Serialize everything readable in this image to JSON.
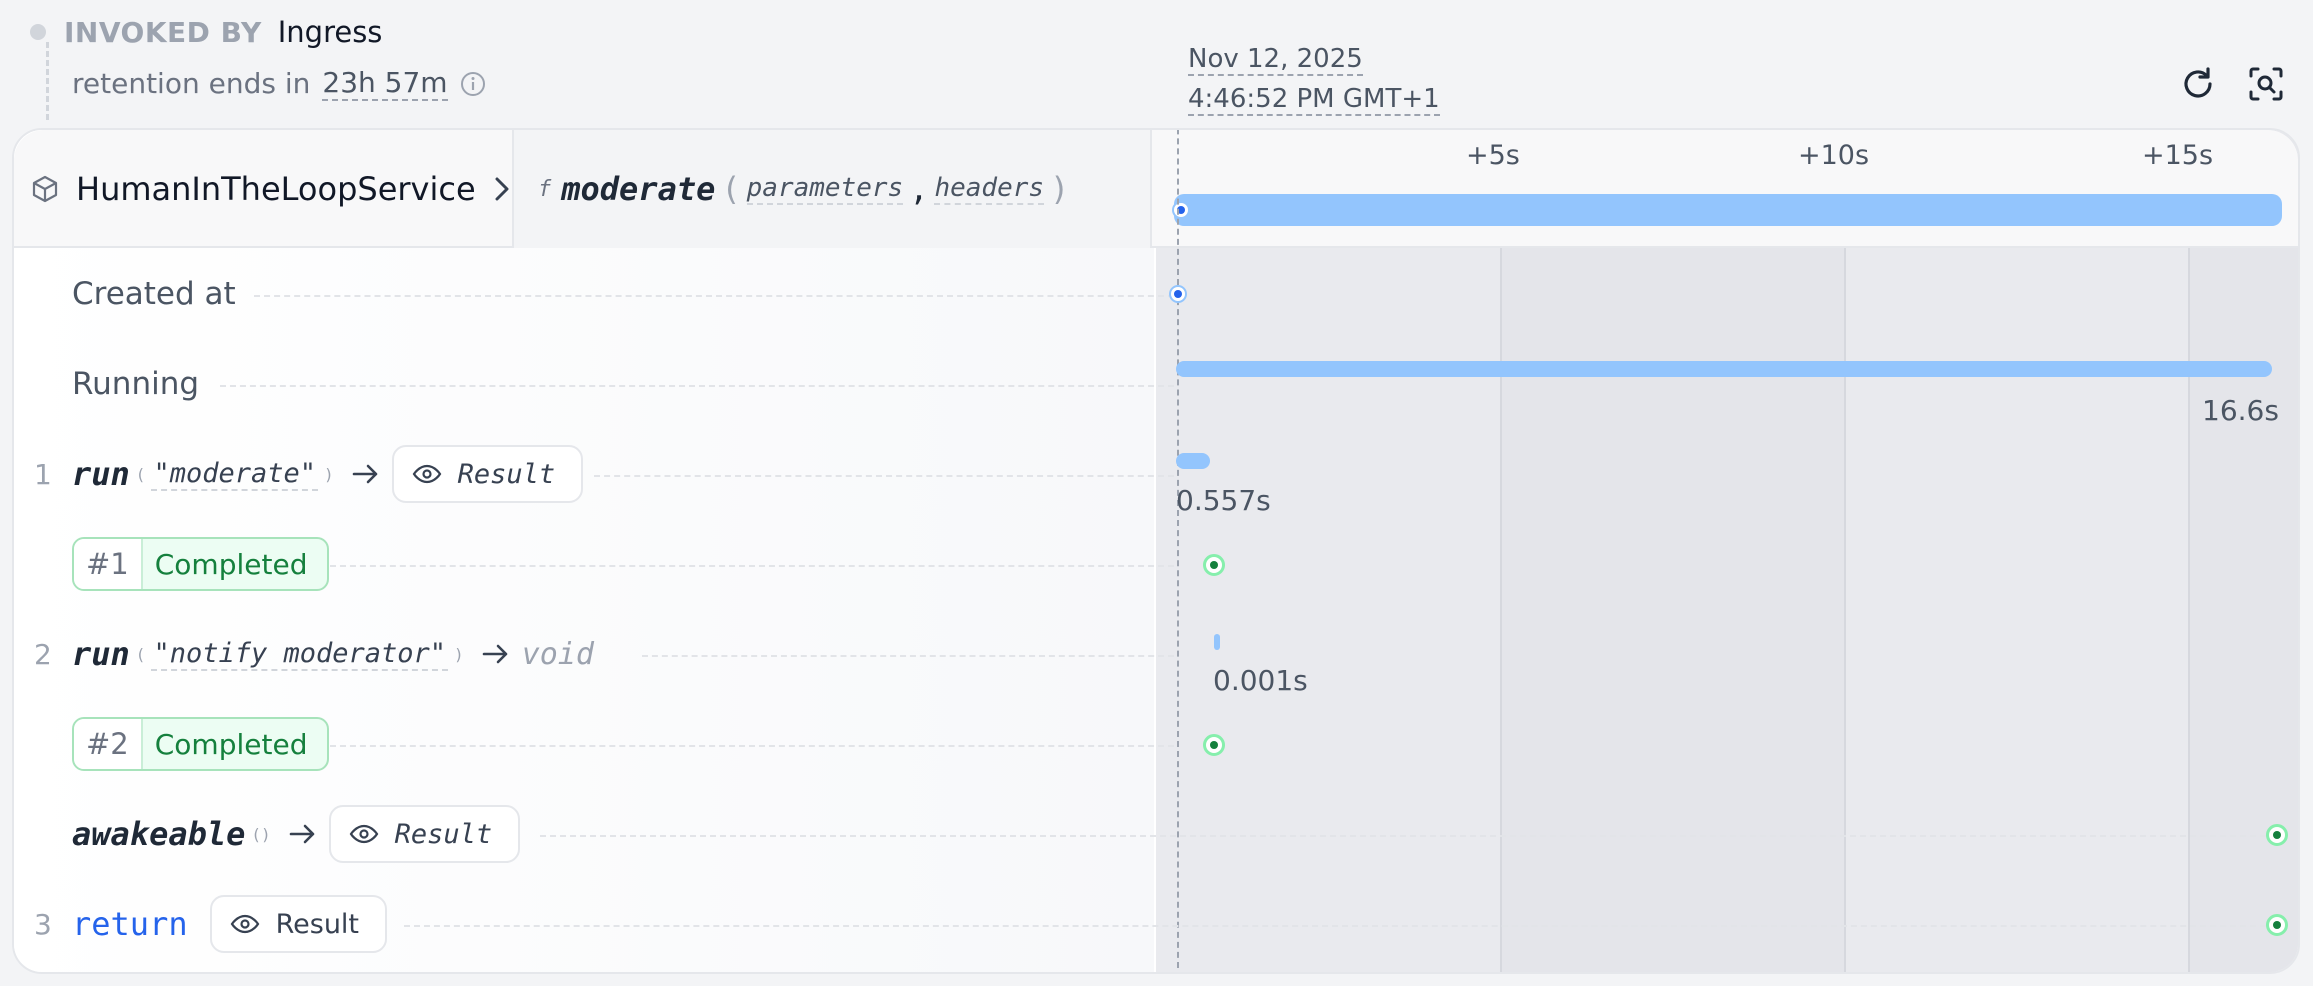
{
  "header": {
    "invoked_by_label": "INVOKED BY",
    "invoked_by_value": "Ingress",
    "retention_label": "retention ends in",
    "retention_value": "23h 57m",
    "timestamp_date": "Nov 12, 2025",
    "timestamp_time": "4:46:52 PM GMT+1"
  },
  "invocation": {
    "service": "HumanInTheLoopService",
    "handler": "moderate",
    "params": [
      "parameters",
      "headers"
    ]
  },
  "timeline": {
    "ticks": [
      "+5s",
      "+10s",
      "+15s"
    ],
    "total_duration": "16.6s"
  },
  "rows": {
    "created_label": "Created at",
    "running_label": "Running",
    "run1": {
      "index": "1",
      "keyword": "run",
      "arg": "\"moderate\"",
      "result_label": "Result",
      "duration": "0.557s"
    },
    "attempt1": {
      "number": "#1",
      "status": "Completed"
    },
    "run2": {
      "index": "2",
      "keyword": "run",
      "arg": "\"notify moderator\"",
      "result": "void",
      "duration": "0.001s"
    },
    "attempt2": {
      "number": "#2",
      "status": "Completed"
    },
    "awakeable": {
      "keyword": "awakeable",
      "result_label": "Result"
    },
    "ret": {
      "index": "3",
      "keyword": "return",
      "result_label": "Result"
    }
  },
  "colors": {
    "accent_blue": "#93c5fd",
    "success_green": "#15803d",
    "return_blue": "#2563eb"
  },
  "icons": [
    "info-icon",
    "refresh-icon",
    "zoom-icon",
    "cube-icon",
    "chevron-right-icon",
    "arrow-right-icon",
    "eye-icon"
  ]
}
